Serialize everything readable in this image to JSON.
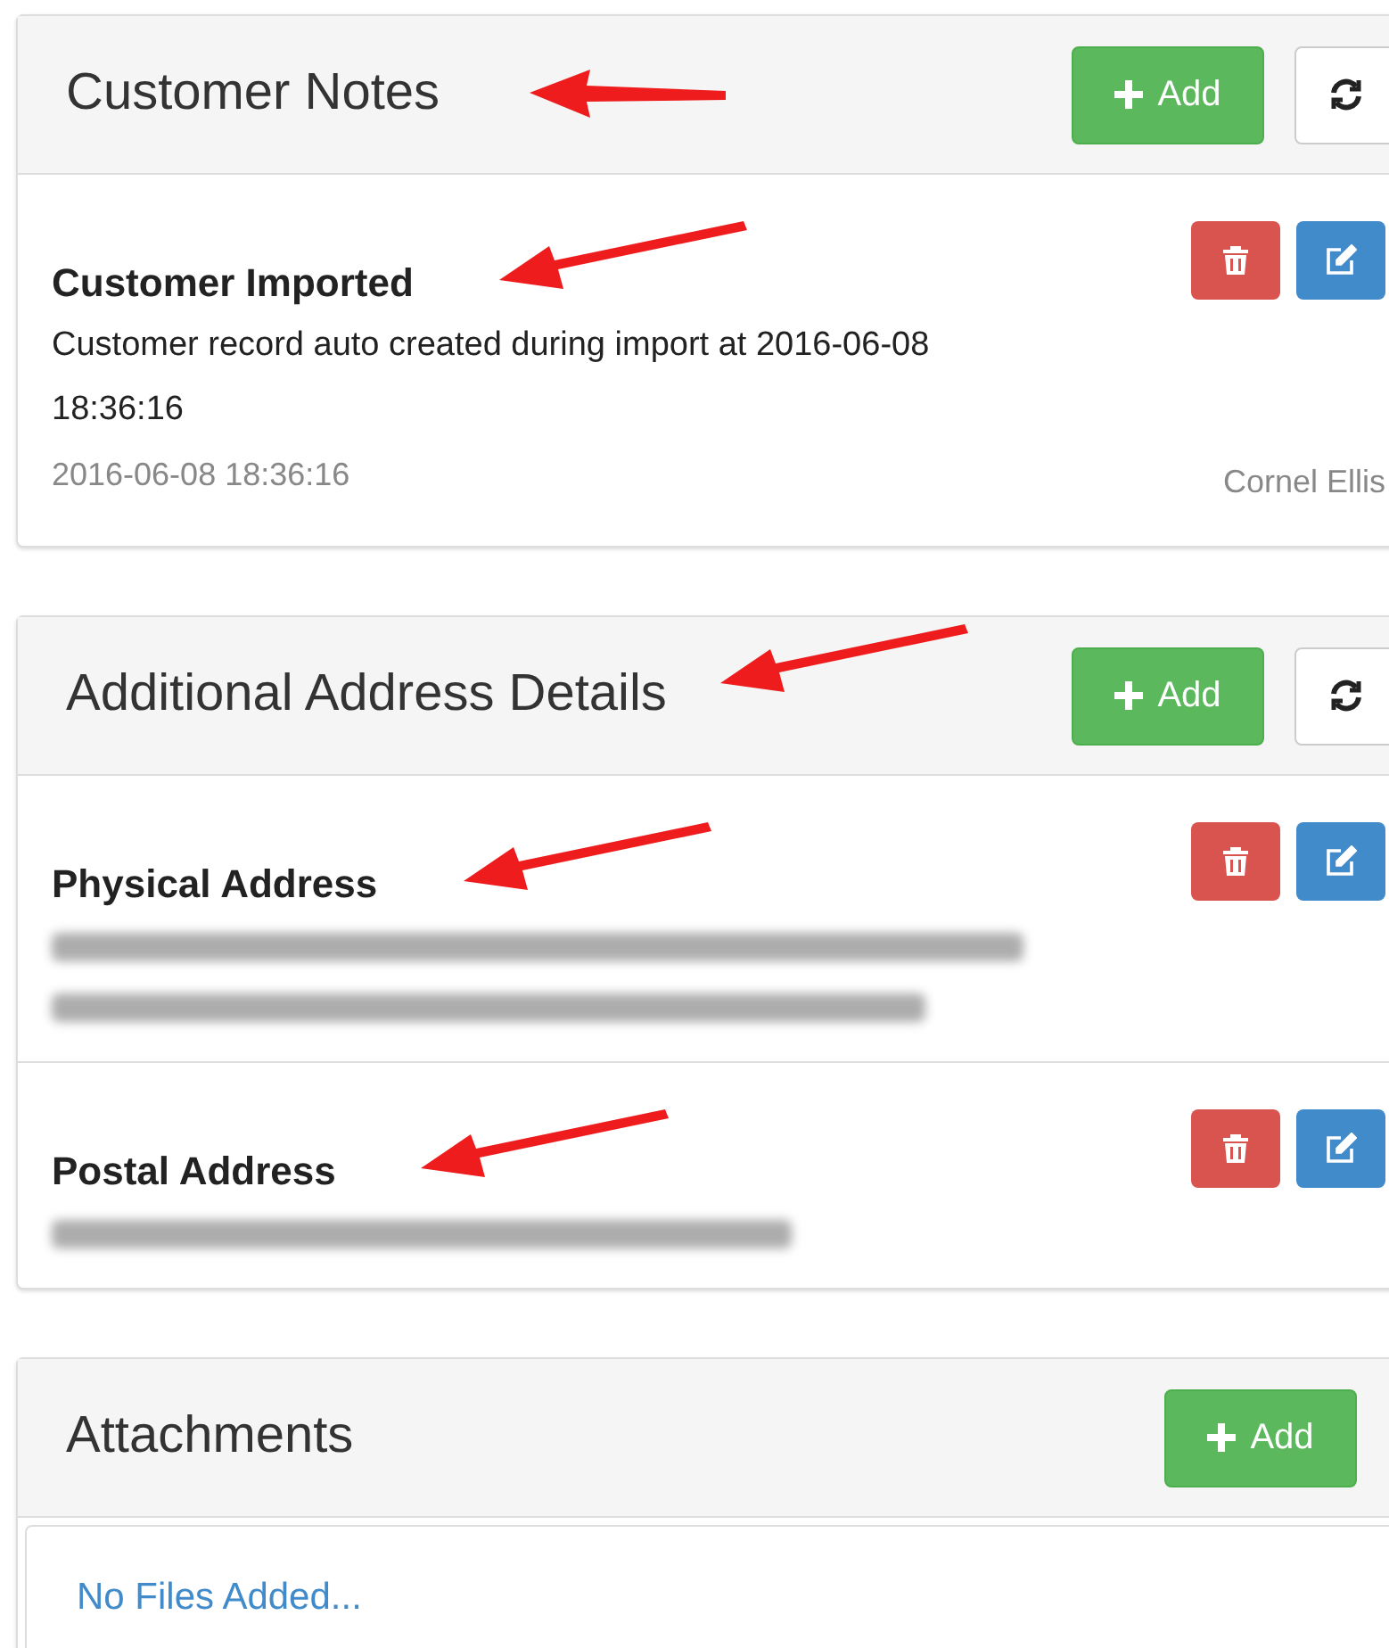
{
  "panels": [
    {
      "title": "Customer Notes",
      "arrow": {
        "kind": "left"
      },
      "buttons": [
        {
          "kind": "add",
          "label": "Add"
        },
        {
          "kind": "refresh"
        }
      ],
      "items": [
        {
          "kind": "note",
          "title": "Customer Imported",
          "arrow": {
            "kind": "up_left"
          },
          "text": "Customer record auto created during import at 2016-06-08 18:36:16",
          "date": "2016-06-08 18:36:16",
          "author": "Cornel Ellis"
        }
      ]
    },
    {
      "title": "Additional Address Details",
      "arrow": {
        "kind": "up_left"
      },
      "buttons": [
        {
          "kind": "add",
          "label": "Add"
        },
        {
          "kind": "refresh"
        }
      ],
      "items": [
        {
          "kind": "blurred",
          "title": "Physical Address",
          "arrow": {
            "kind": "up_left"
          },
          "blurred_lines": [
            {
              "kind": "long"
            },
            {
              "kind": "medium"
            }
          ]
        },
        {
          "kind": "blurred",
          "title": "Postal Address",
          "arrow": {
            "kind": "up_left"
          },
          "blurred_lines": [
            {
              "kind": "short"
            }
          ]
        }
      ]
    },
    {
      "title": "Attachments",
      "buttons": [
        {
          "kind": "add",
          "label": "Add"
        }
      ],
      "empty_text": "No Files Added..."
    }
  ]
}
